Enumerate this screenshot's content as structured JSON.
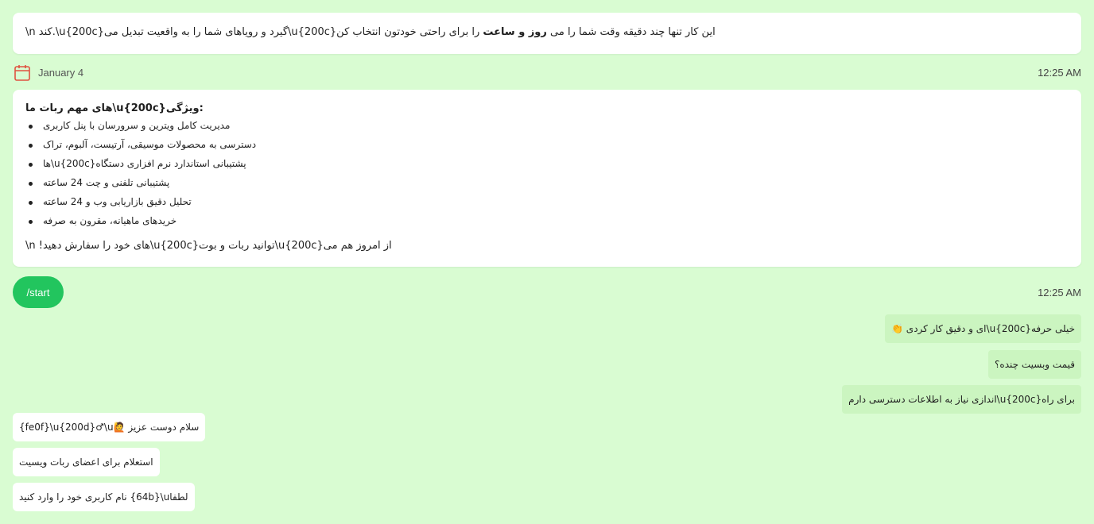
{
  "intro_card": {
    "part_a": "\\n ",
    "part_b": "کند.\\u{200c}گیرد و رویاهای شما را به واقعیت تبدیل می\\u{200c}این کار تنها چند دقیقه وقت شما را می ",
    "bold": "روز و ساعت",
    "part_c": " را برای راحتی خودتون انتخاب کن"
  },
  "date_row": {
    "date": "January 4",
    "time": "12:25 AM"
  },
  "features_card": {
    "heading": "های مهم ربات ما\\u{200c}ویژگی:",
    "items": [
      "مدیریت کامل ویترین و سرورسان با پنل کاربری",
      "دسترسی به محصولات موسیقی، آرتیست، آلبوم، تراک",
      "ها\\u{200c}پشتیبانی استاندارد نرم افزاری دستگاه",
      "پشتیبانی تلفنی و چت 24 ساعته",
      "تحلیل دقیق بازاریابی وب و 24 ساعته",
      "خریدهای ماهیانه، مقرون به صرفه"
    ],
    "footer": "\\n !های خود را سفارش دهید\\u{200c}توانید ربات و بوت\\u{200c}از امروز هم می"
  },
  "start_button": {
    "label": "/start"
  },
  "start_time": "12:25 AM",
  "outgoing": [
    "👏 ای و دقیق کار کردی\\u{200c}خیلی حرفه",
    "قیمت وبسیت چنده؟",
    "اندازی نیاز به اطلاعات دسترسی دارم\\u{200c}برای راه"
  ],
  "incoming": [
    "{fe0f}\\u{200d}♂\\u🙋 سلام دوست عزیز",
    "استعلام برای اعضای ربات ویسیت",
    "نام کاربری خود را وارد کنید {64b}\\uلطفا"
  ],
  "colors": {
    "background": "#d9fcd2",
    "accent": "#22c55e",
    "calendar_icon": "#e0523f",
    "outgoing_bubble": "#cbf5c0"
  }
}
